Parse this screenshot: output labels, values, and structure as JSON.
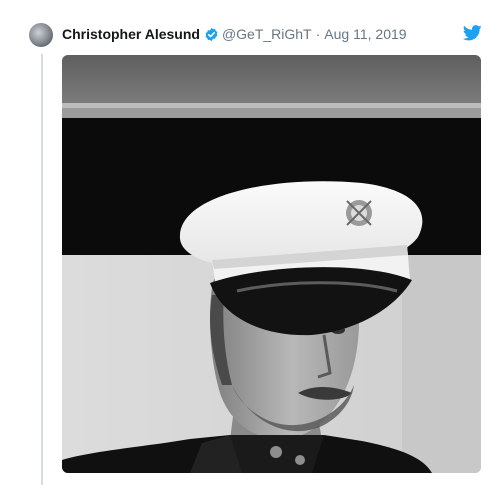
{
  "tweet": {
    "author_name": "Christopher Alesund",
    "handle": "@GeT_RiGhT",
    "separator": "·",
    "date": "Aug 11, 2019"
  },
  "icons": {
    "verified": "verified-badge-icon",
    "platform": "twitter-bird-icon"
  },
  "colors": {
    "brand": "#1da1f2",
    "name": "#14171a",
    "secondary": "#657786",
    "thread_line": "#d6dde2"
  }
}
